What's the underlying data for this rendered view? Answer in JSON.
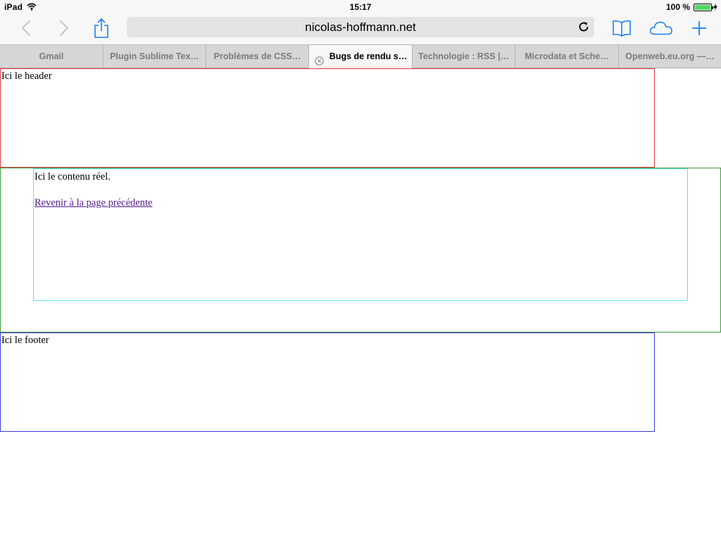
{
  "status_bar": {
    "device": "iPad",
    "time": "15:17",
    "battery_text": "100 %",
    "battery_level": 1.0
  },
  "toolbar": {
    "url": "nicolas-hoffmann.net",
    "icons": [
      "back-icon",
      "forward-icon",
      "share-icon",
      "reload-icon",
      "bookmarks-icon",
      "icloud-tabs-icon",
      "new-tab-icon"
    ]
  },
  "tabs": [
    {
      "label": "Gmail",
      "active": false
    },
    {
      "label": "Plugin Sublime Tex…",
      "active": false
    },
    {
      "label": "Problèmes de CSS…",
      "active": false
    },
    {
      "label": "Bugs de rendu s…",
      "active": true
    },
    {
      "label": "Technologie : RSS |…",
      "active": false
    },
    {
      "label": "Microdata et Sche…",
      "active": false
    },
    {
      "label": "Openweb.eu.org —…",
      "active": false
    }
  ],
  "page": {
    "header_text": "Ici le header",
    "content_text": "Ici le contenu réel.",
    "link_text": "Revenir à la page précédente",
    "footer_text": "Ici le footer"
  },
  "colors": {
    "header_border": "#e4363d",
    "main_border": "#3d9a3d",
    "content_border": "#5fe3e3",
    "footer_border": "#3a3ae6",
    "ios_blue": "#1a7ff0",
    "battery_green": "#4cd964"
  }
}
